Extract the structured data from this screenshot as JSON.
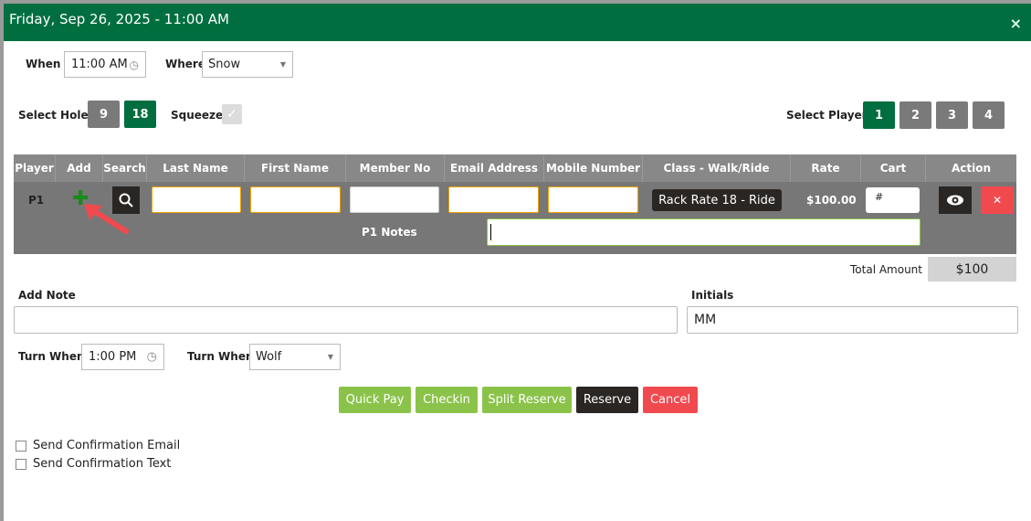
{
  "header": {
    "title": "Friday, Sep 26, 2025 - 11:00 AM",
    "close": "×"
  },
  "when": {
    "label": "When",
    "value": "11:00 AM"
  },
  "where": {
    "label": "Where",
    "value": "Snow"
  },
  "holes": {
    "label": "Select Holes",
    "options": [
      "9",
      "18"
    ],
    "selected": "18"
  },
  "squeeze": {
    "label": "Squeeze",
    "checked": true
  },
  "players": {
    "label": "Select Players",
    "options": [
      "1",
      "2",
      "3",
      "4"
    ],
    "selected": "1"
  },
  "table": {
    "columns": [
      "Player",
      "Add",
      "Search",
      "Last Name",
      "First Name",
      "Member No",
      "Email Address",
      "Mobile Number",
      "Class - Walk/Ride",
      "Rate",
      "Cart",
      "Action"
    ],
    "row": {
      "player": "P1",
      "last_name": "",
      "first_name": "",
      "member_no": "",
      "email": "",
      "mobile": "",
      "class": "Rack Rate 18 - Ride",
      "rate": "$100.00",
      "cart_placeholder": "#",
      "notes_label": "P1 Notes",
      "notes": ""
    }
  },
  "total": {
    "label": "Total Amount",
    "value": "$100"
  },
  "add_note": {
    "label": "Add Note",
    "value": ""
  },
  "initials": {
    "label": "Initials",
    "value": "MM"
  },
  "turn_when": {
    "label": "Turn When",
    "value": "1:00 PM"
  },
  "turn_where": {
    "label": "Turn Where",
    "value": "Wolf"
  },
  "actions": {
    "quick_pay": "Quick Pay",
    "checkin": "Checkin",
    "split_reserve": "Split Reserve",
    "reserve": "Reserve",
    "cancel": "Cancel"
  },
  "confirm": {
    "email": "Send Confirmation Email",
    "text": "Send Confirmation Text"
  },
  "colors": {
    "brand": "#006e3f",
    "light_green": "#8bc34a",
    "cancel": "#f04a4f",
    "dark": "#2a2623"
  }
}
